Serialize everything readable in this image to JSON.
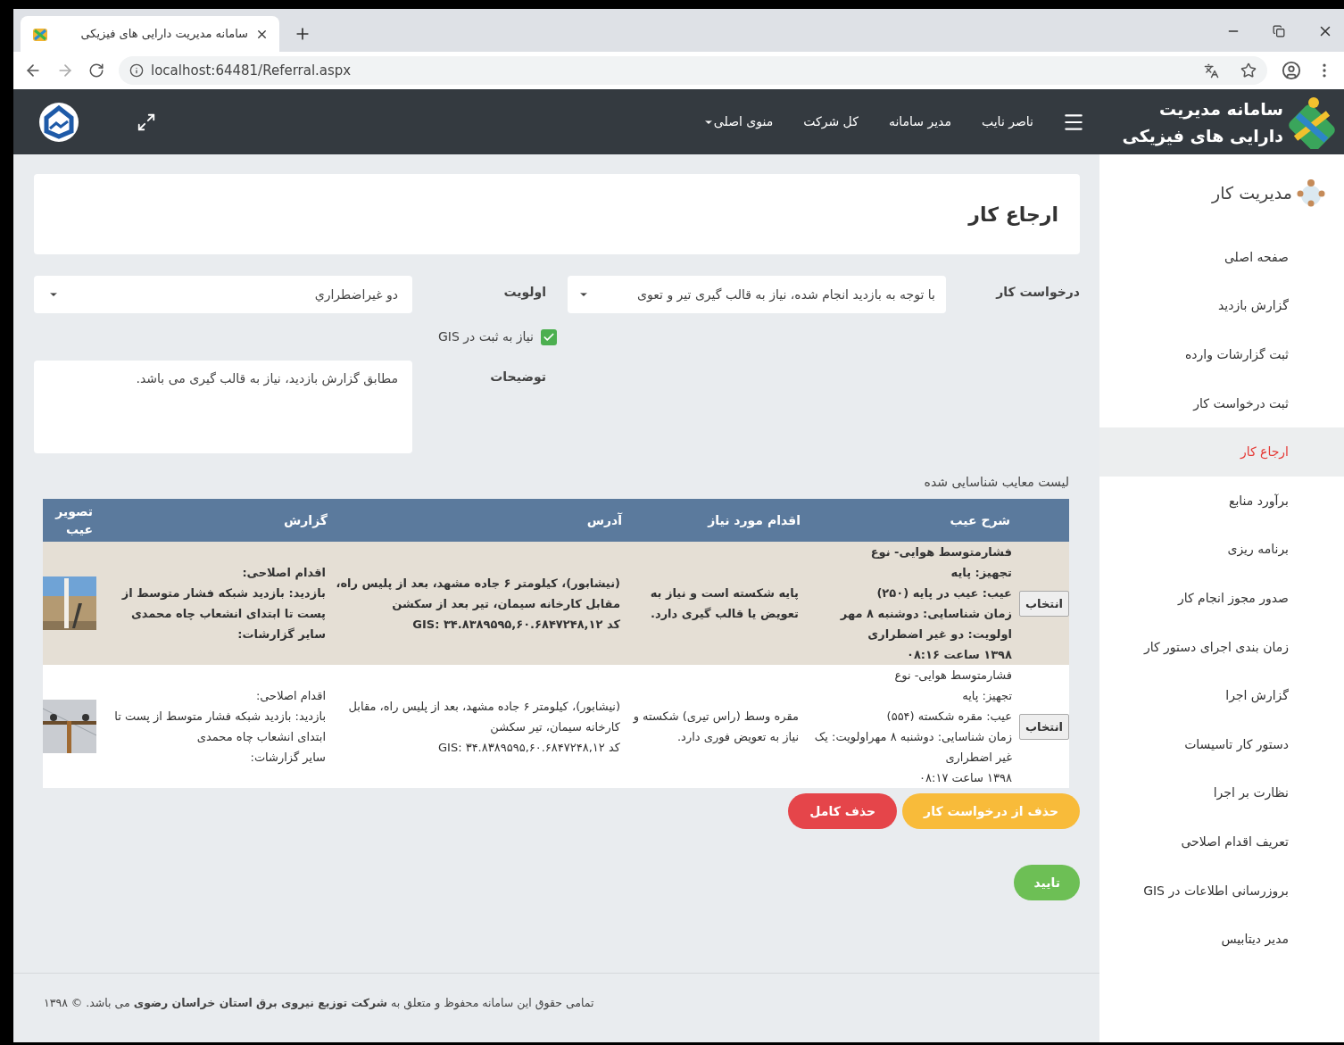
{
  "browser": {
    "tab_title": "سامانه مدیریت دارایی های فیزیکی",
    "url": "localhost:64481/Referral.aspx"
  },
  "header": {
    "brand_lines": [
      "سامانه مدیریت",
      "دارایی های فیزیکی"
    ],
    "menu": [
      {
        "label": "ناصر نایب",
        "kind": "link"
      },
      {
        "label": "مدیر سامانه",
        "kind": "link"
      },
      {
        "label": "کل شرکت",
        "kind": "link"
      },
      {
        "label": "منوی اصلی",
        "kind": "dropdown"
      }
    ]
  },
  "sidebar": {
    "heading": "مدیریت کار",
    "items": [
      {
        "label": "صفحه اصلی",
        "selected": false
      },
      {
        "label": "گزارش بازدید",
        "selected": false
      },
      {
        "label": "ثبت گزارشات وارده",
        "selected": false
      },
      {
        "label": "ثبت درخواست کار",
        "selected": false
      },
      {
        "label": "ارجاع کار",
        "selected": true
      },
      {
        "label": "برآورد منابع",
        "selected": false
      },
      {
        "label": "برنامه ریزی",
        "selected": false
      },
      {
        "label": "صدور مجوز انجام کار",
        "selected": false
      },
      {
        "label": "زمان بندی اجرای دستور کار",
        "selected": false
      },
      {
        "label": "گزارش اجرا",
        "selected": false
      },
      {
        "label": "دستور کار تاسیسات",
        "selected": false
      },
      {
        "label": "نظارت بر اجرا",
        "selected": false
      },
      {
        "label": "تعریف اقدام اصلاحی",
        "selected": false
      },
      {
        "label": "بروزرسانی اطلاعات در GIS",
        "selected": false
      },
      {
        "label": "مدیر دیتابیس",
        "selected": false
      }
    ]
  },
  "page_title": "ارجاع کار",
  "form": {
    "work_request": {
      "label": "درخواست کار",
      "value": "با توجه به بازدید انجام شده، نیاز به قالب گیری تیر و تعوی"
    },
    "priority": {
      "label": "اولویت",
      "value": "دو غیراضطراري"
    },
    "gis": {
      "label": "نیاز به ثبت در GIS",
      "checked": true
    },
    "notes": {
      "label": "توضیحات",
      "value": "مطابق گزارش بازدید، نیاز به قالب گیری  می باشد."
    }
  },
  "defects": {
    "title": "لیست معایب شناسایی شده",
    "columns": [
      "شرح عیب",
      "اقدام مورد نیاز",
      "آدرس",
      "گزارش",
      "تصویر عیب"
    ],
    "rows": [
      {
        "selected": true,
        "button": "انتخاب",
        "defect": "فشارمتوسط هوایی- نوع\nتجهیز: پایه\nعیب: عیب در پایه (۲۵۰)\nزمان شناسایی: دوشنبه ۸ مهر اولویت: دو غیر اضطراری\n۱۳۹۸ ساعت ۰۸:۱۶",
        "action": "پایه شکسته است و نیاز به تعویض یا قالب گیری دارد.",
        "address": "(نیشابور)، کیلومتر ۶ جاده مشهد، بعد از پلیس راه، مقابل کارخانه سیمان، تیر بعد از سکشن\nکد GIS: ۳۴.۸۳۸۹۵۹۵,۶۰.۶۸۴۷۲۴۸,۱۲",
        "report": "اقدام اصلاحی:\nبازدید: بازدید شبکه فشار متوسط از پست تا ابتدای انشعاب چاه محمدی\nسایر گزارشات:"
      },
      {
        "selected": false,
        "button": "انتخاب",
        "defect": "فشارمتوسط هوایی- نوع\nتجهیز: پایه\nعیب: مقره شکسته (۵۵۴)\nزمان شناسایی: دوشنبه ۸ مهراولویت: یک غیر اضطراری\n۱۳۹۸ ساعت ۰۸:۱۷",
        "action": "مقره وسط (راس تیری) شکسته و نیاز به تعویض فوری دارد.",
        "address": "(نیشابور)، کیلومتر ۶ جاده مشهد، بعد از پلیس راه، مقابل کارخانه سیمان، تیر سکشن\nکد GIS: ۳۴.۸۳۸۹۵۹۵,۶۰.۶۸۴۷۲۴۸,۱۲",
        "report": "اقدام اصلاحی:\nبازدید: بازدید شبکه فشار متوسط از پست تا ابتدای انشعاب چاه محمدی\nسایر گزارشات:"
      }
    ]
  },
  "buttons": [
    {
      "label": "حذف از درخواست کار",
      "kind": "warning"
    },
    {
      "label": "حذف کامل",
      "kind": "danger"
    },
    {
      "label": "تایید",
      "kind": "success"
    }
  ],
  "footer": "تمامی حقوق این سامانه محفوظ و متعلق به **شرکت توزیع نیروی برق استان خراسان رضوی** می باشد. © ۱۳۹۸"
}
